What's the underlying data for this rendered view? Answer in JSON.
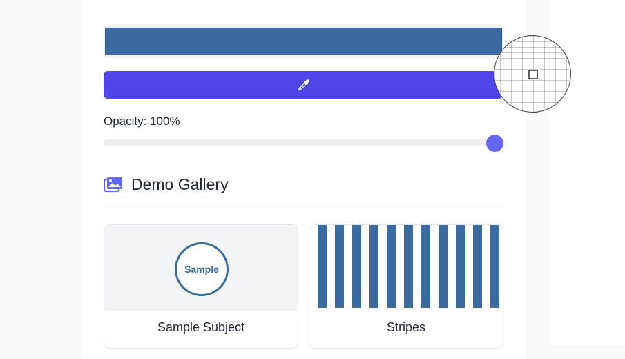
{
  "picker": {
    "color_hex": "#3b6a9e",
    "eyedropper_icon": "eyedropper-icon",
    "opacity_label": "Opacity: 100%",
    "opacity_value": 1.0
  },
  "gallery": {
    "title": "Demo Gallery",
    "icon": "images-icon",
    "cards": [
      {
        "caption": "Sample Subject",
        "media_text": "Sample"
      },
      {
        "caption": "Stripes"
      }
    ]
  },
  "colors": {
    "accent": "#4f46e5",
    "slider": "#6366f1",
    "swatch": "#3b6a9e"
  }
}
